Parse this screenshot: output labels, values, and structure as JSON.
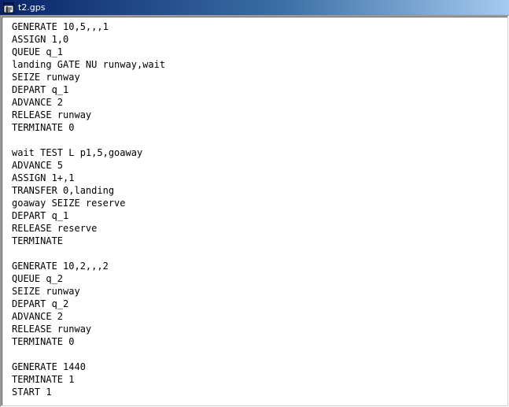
{
  "window": {
    "title": "t2.gps",
    "icon": "document-icon"
  },
  "editor": {
    "lines": [
      "GENERATE 10,5,,,1",
      "ASSIGN 1,0",
      "QUEUE q_1",
      "landing GATE NU runway,wait",
      "SEIZE runway",
      "DEPART q_1",
      "ADVANCE 2",
      "RELEASE runway",
      "TERMINATE 0",
      "",
      "wait TEST L p1,5,goaway",
      "ADVANCE 5",
      "ASSIGN 1+,1",
      "TRANSFER 0,landing",
      "goaway SEIZE reserve",
      "DEPART q_1",
      "RELEASE reserve",
      "TERMINATE",
      "",
      "GENERATE 10,2,,,2",
      "QUEUE q_2",
      "SEIZE runway",
      "DEPART q_2",
      "ADVANCE 2",
      "RELEASE runway",
      "TERMINATE 0",
      "",
      "GENERATE 1440",
      "TERMINATE 1",
      "START 1"
    ]
  }
}
